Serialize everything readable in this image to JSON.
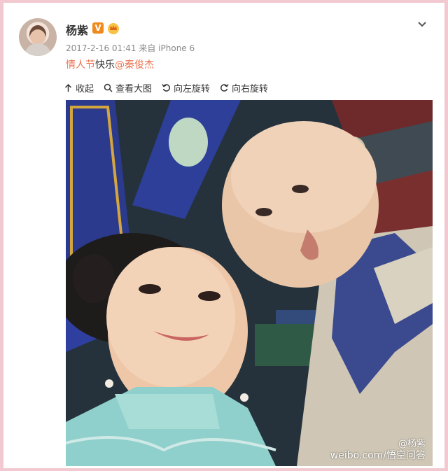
{
  "post": {
    "username": "杨紫",
    "verified_badge": "V",
    "timestamp": "2017-2-16 01:41",
    "source_prefix": "来自",
    "source": "iPhone 6",
    "text_tag": "情人节",
    "text_plain": "快乐",
    "text_mention": "@秦俊杰"
  },
  "toolbar": {
    "collapse_label": "收起",
    "view_large_label": "查看大图",
    "rotate_left_label": "向左旋转",
    "rotate_right_label": "向右旋转"
  },
  "photo": {
    "watermark_handle": "@杨紫",
    "watermark_site": "weibo.com/",
    "watermark_overlay": "悟空问答"
  },
  "icons": {
    "menu": "chevron-down-icon",
    "collapse": "arrow-up-icon",
    "zoom": "search-icon",
    "rotate_left": "rotate-left-icon",
    "rotate_right": "rotate-right-icon",
    "badge": "crown-icon"
  },
  "colors": {
    "accent": "#eb7350",
    "vip_orange": "#f08a1c",
    "page_frame": "#f2c9d1"
  }
}
